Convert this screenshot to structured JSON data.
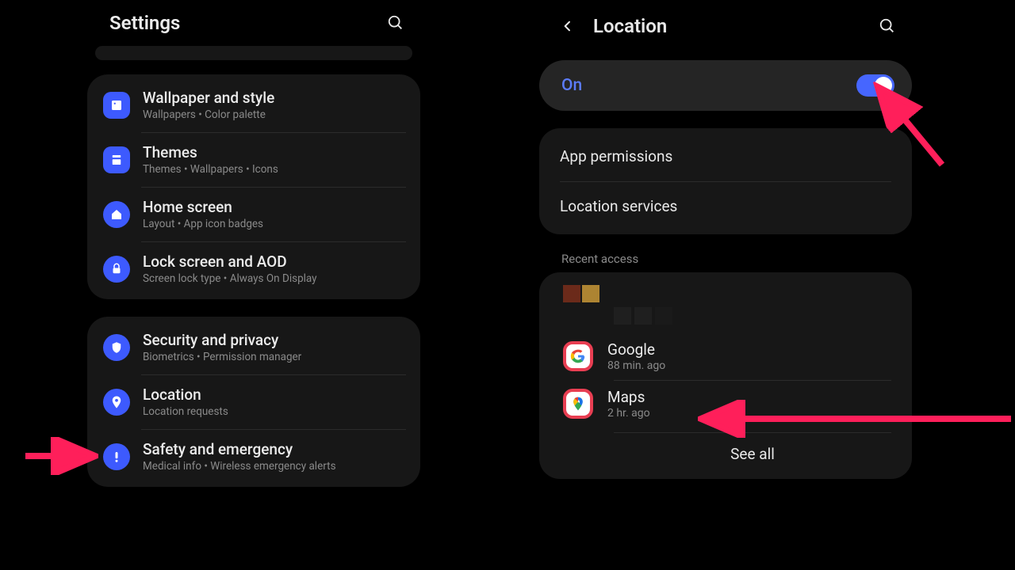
{
  "left": {
    "title": "Settings",
    "group1": [
      {
        "icon": "wallpaper",
        "title": "Wallpaper and style",
        "sub": "Wallpapers  •  Color palette"
      },
      {
        "icon": "themes",
        "title": "Themes",
        "sub": "Themes  •  Wallpapers  •  Icons"
      },
      {
        "icon": "home",
        "title": "Home screen",
        "sub": "Layout  •  App icon badges"
      },
      {
        "icon": "lock",
        "title": "Lock screen and AOD",
        "sub": "Screen lock type  •  Always On Display"
      }
    ],
    "group2": [
      {
        "icon": "shield",
        "title": "Security and privacy",
        "sub": "Biometrics  •  Permission manager"
      },
      {
        "icon": "pin",
        "title": "Location",
        "sub": "Location requests"
      },
      {
        "icon": "alert",
        "title": "Safety and emergency",
        "sub": "Medical info  •  Wireless emergency alerts"
      }
    ]
  },
  "right": {
    "title": "Location",
    "toggle_label": "On",
    "links": [
      "App permissions",
      "Location services"
    ],
    "section": "Recent access",
    "apps": [
      {
        "name": "Google",
        "time": "88 min. ago",
        "icon": "google"
      },
      {
        "name": "Maps",
        "time": "2 hr. ago",
        "icon": "maps"
      }
    ],
    "see_all": "See all"
  }
}
